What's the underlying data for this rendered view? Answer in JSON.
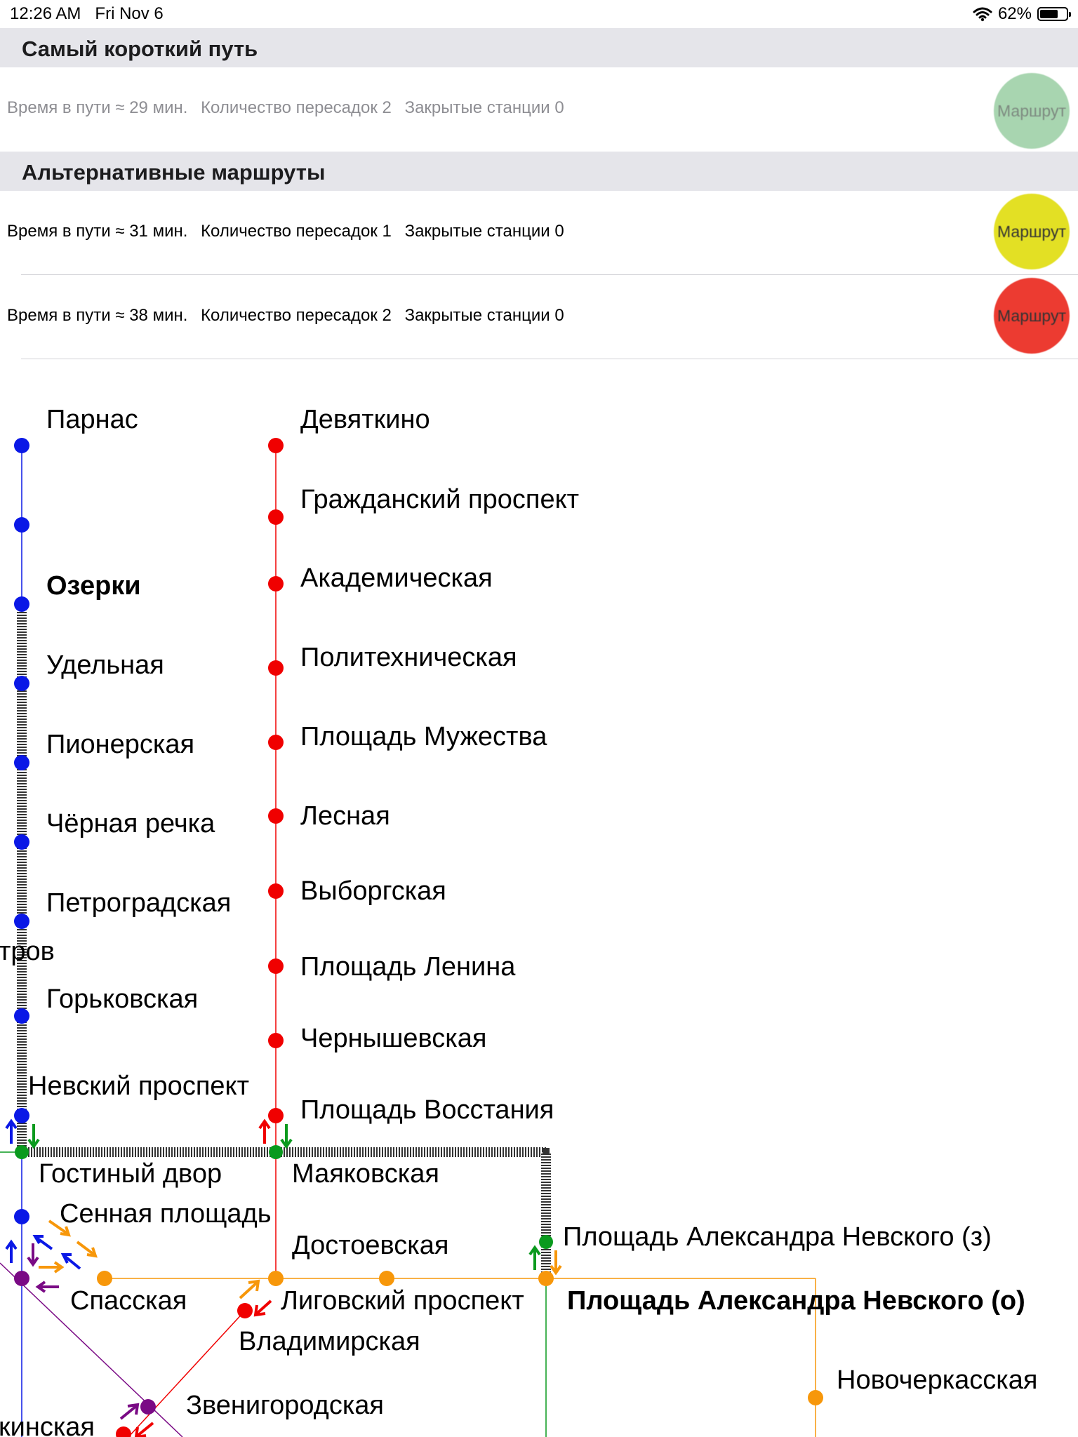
{
  "status_bar": {
    "time": "12:26 AM",
    "date": "Fri Nov 6",
    "battery": "62%"
  },
  "shortest": {
    "header": "Самый короткий путь",
    "route": {
      "time_label": "Время в пути ≈",
      "time_value": "29 мин.",
      "transfers_label": "Количество пересадок",
      "transfers_value": "2",
      "closed_label": "Закрытые станции",
      "closed_value": "0",
      "button": "Маршрут",
      "color": "#a8d5b0"
    }
  },
  "alternatives": {
    "header": "Альтернативные маршруты",
    "routes": [
      {
        "time_label": "Время в пути ≈",
        "time_value": "31 мин.",
        "transfers_label": "Количество пересадок",
        "transfers_value": "1",
        "closed_label": "Закрытые станции",
        "closed_value": "0",
        "button": "Маршрут",
        "color": "#e3e024"
      },
      {
        "time_label": "Время в пути ≈",
        "time_value": "38 мин.",
        "transfers_label": "Количество пересадок",
        "transfers_value": "2",
        "closed_label": "Закрытые станции",
        "closed_value": "0",
        "button": "Маршрут",
        "color": "#ec3b31"
      }
    ]
  },
  "map": {
    "colors": {
      "blue": "#0a18e6",
      "red": "#f00000",
      "green": "#0a9a1e",
      "orange": "#f7970a",
      "purple": "#7a0a85",
      "route": "#333333"
    },
    "stations": {
      "parnas": "Парнас",
      "ozerki": "Озерки",
      "udelnaya": "Удельная",
      "pionerskaya": "Пионерская",
      "chernaya": "Чёрная речка",
      "petrogradskaya": "Петроградская",
      "ostrov_cut": "тров",
      "gorkovskaya": "Горьковская",
      "nevsky": "Невский проспект",
      "gostiny": "Гостиный двор",
      "sennaya": "Сенная площадь",
      "spasskaya": "Спасская",
      "sadovaya_cut": "кинская",
      "devyatkino": "Девяткино",
      "grazhdansky": "Гражданский проспект",
      "akademicheskaya": "Академическая",
      "polytech": "Политехническая",
      "muzhestva": "Площадь Мужества",
      "lesnaya": "Лесная",
      "vyborgskaya": "Выборгская",
      "lenina": "Площадь Ленина",
      "chernyshevskaya": "Чернышевская",
      "vosstaniya": "Площадь Восстания",
      "mayakovskaya": "Маяковская",
      "dostoevskaya": "Достоевская",
      "ligovsky": "Лиговский проспект",
      "vladimirskaya": "Владимирская",
      "zvenigorodskaya": "Звенигородская",
      "nevsky_z": "Площадь Александра Невского (з)",
      "nevsky_o": "Площадь Александра Невского (о)",
      "novocherkasskaya": "Новочеркасская"
    }
  }
}
